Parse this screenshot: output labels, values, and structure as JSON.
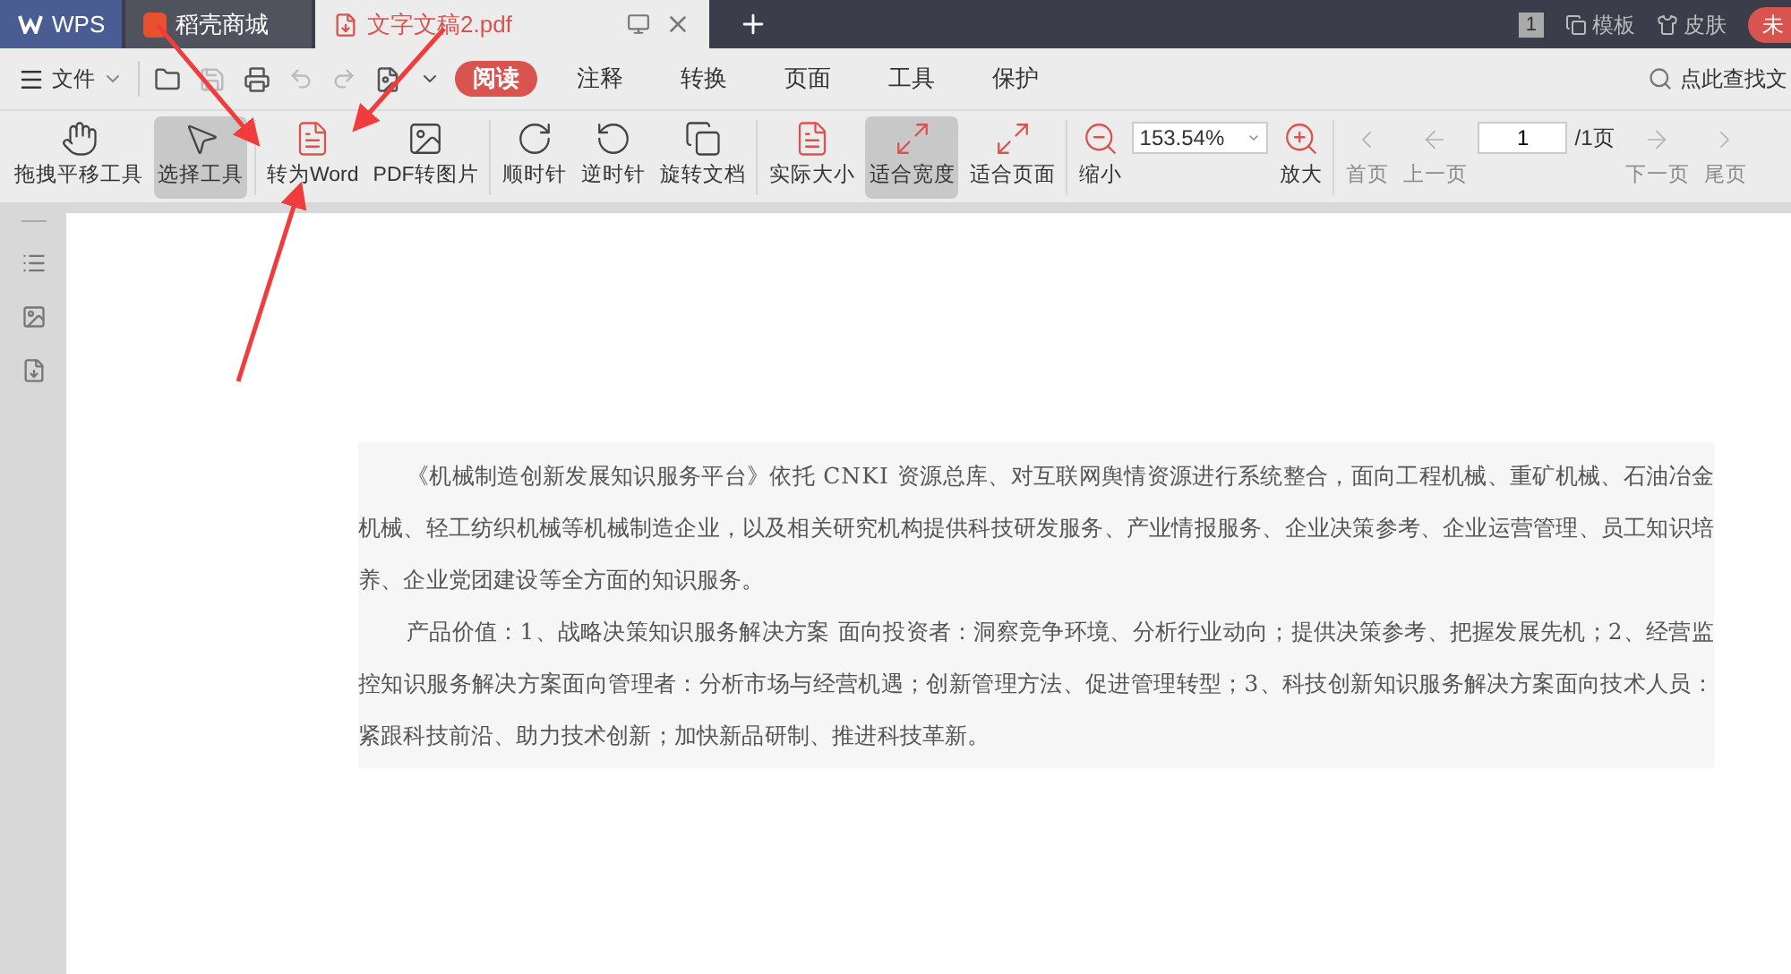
{
  "tabs": [
    {
      "label": "WPS",
      "kind": "home",
      "selected": false
    },
    {
      "label": "稻壳商城",
      "kind": "store",
      "selected": false
    },
    {
      "label": "文字文稿2.pdf",
      "kind": "doc",
      "selected": true
    }
  ],
  "title_bar": {
    "badge": "1",
    "links": [
      "模板",
      "皮肤"
    ],
    "avatar": "未"
  },
  "menu": {
    "file": "文件",
    "ribbon_tabs": [
      {
        "label": "阅读",
        "selected": true
      },
      {
        "label": "注释",
        "selected": false
      },
      {
        "label": "转换",
        "selected": false
      },
      {
        "label": "页面",
        "selected": false
      },
      {
        "label": "工具",
        "selected": false
      },
      {
        "label": "保护",
        "selected": false
      }
    ],
    "search": {
      "placeholder": "点此查找文"
    }
  },
  "toolbar": [
    {
      "kind": "hand",
      "label": "拖拽平移工具",
      "selected": false,
      "disabled": false
    },
    {
      "kind": "pointer",
      "label": "选择工具",
      "selected": true,
      "disabled": false
    },
    {
      "kind": "sep"
    },
    {
      "kind": "to_word",
      "label": "转为Word",
      "selected": false,
      "disabled": false
    },
    {
      "kind": "to_image",
      "label": "PDF转图片",
      "selected": false,
      "disabled": false
    },
    {
      "kind": "sep"
    },
    {
      "kind": "cw",
      "label": "顺时针",
      "selected": false,
      "disabled": false
    },
    {
      "kind": "ccw",
      "label": "逆时针",
      "selected": false,
      "disabled": false
    },
    {
      "kind": "rotate_doc",
      "label": "旋转文档",
      "selected": false,
      "disabled": false
    },
    {
      "kind": "sep"
    },
    {
      "kind": "actual",
      "label": "实际大小",
      "selected": false,
      "disabled": false
    },
    {
      "kind": "fit_width",
      "label": "适合宽度",
      "selected": true,
      "disabled": false
    },
    {
      "kind": "fit_page",
      "label": "适合页面",
      "selected": false,
      "disabled": false
    },
    {
      "kind": "sep"
    },
    {
      "kind": "zoom_out",
      "label": "缩小",
      "selected": false,
      "disabled": false
    },
    {
      "kind": "zoom_field",
      "value": "153.54%"
    },
    {
      "kind": "zoom_in",
      "label": "放大",
      "selected": false,
      "disabled": false
    },
    {
      "kind": "sep"
    },
    {
      "kind": "first",
      "label": "首页",
      "selected": false,
      "disabled": true
    },
    {
      "kind": "prev",
      "label": "上一页",
      "selected": false,
      "disabled": true
    },
    {
      "kind": "page_field",
      "value": "1",
      "total": "/1页"
    },
    {
      "kind": "next",
      "label": "下一页",
      "selected": false,
      "disabled": true
    },
    {
      "kind": "last",
      "label": "尾页",
      "selected": false,
      "disabled": true
    }
  ],
  "document": {
    "paragraphs": [
      "《机械制造创新发展知识服务平台》依托 CNKI 资源总库、对互联网舆情资源进行系统整合，面向工程机械、重矿机械、石油冶金机械、轻工纺织机械等机械制造企业，以及相关研究机构提供科技研发服务、产业情报服务、企业决策参考、企业运营管理、员工知识培养、企业党团建设等全方面的知识服务。",
      "产品价值：1、战略决策知识服务解决方案 面向投资者：洞察竞争环境、分析行业动向；提供决策参考、把握发展先机；2、经营监控知识服务解决方案面向管理者：分析市场与经营机遇；创新管理方法、促进管理转型；3、科技创新知识服务解决方案面向技术人员：紧跟科技前沿、助力技术创新；加快新品研制、推进科技革新。"
    ]
  }
}
